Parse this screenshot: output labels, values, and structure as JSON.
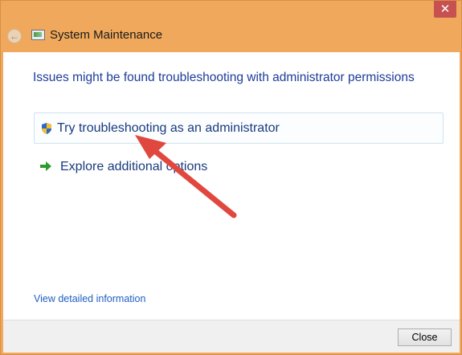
{
  "window": {
    "title": "System Maintenance",
    "close_glyph": "✕",
    "back_glyph": "←"
  },
  "main": {
    "heading": "Issues might be found troubleshooting with administrator permissions",
    "options": [
      {
        "label": "Try troubleshooting as an administrator",
        "icon": "shield-icon"
      },
      {
        "label": "Explore additional options",
        "icon": "green-arrow-icon"
      }
    ],
    "detail_link": "View detailed information"
  },
  "footer": {
    "close_label": "Close"
  },
  "colors": {
    "titlebar": "#f0a95c",
    "heading": "#1e3c9a",
    "link": "#1e5fc2",
    "annotation_arrow": "#e0483f"
  }
}
